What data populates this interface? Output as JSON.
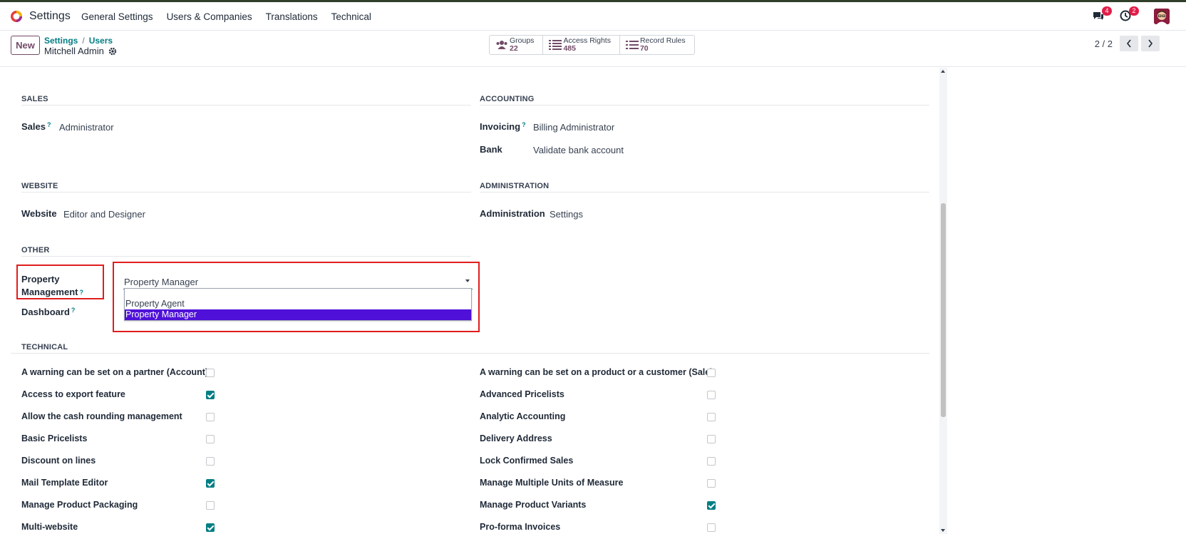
{
  "app": {
    "name": "Settings"
  },
  "menu": [
    "General Settings",
    "Users & Companies",
    "Translations",
    "Technical"
  ],
  "notifications": {
    "messages_count": "4",
    "activities_count": "2"
  },
  "control": {
    "new_label": "New",
    "breadcrumb": [
      "Settings",
      "Users"
    ],
    "record_name": "Mitchell Admin",
    "stats": [
      {
        "label": "Groups",
        "value": "22"
      },
      {
        "label": "Access Rights",
        "value": "485"
      },
      {
        "label": "Record Rules",
        "value": "70"
      }
    ],
    "pager": "2 / 2"
  },
  "sections": {
    "sales": {
      "title": "SALES",
      "fields": [
        {
          "label": "Sales",
          "value": "Administrator"
        }
      ]
    },
    "accounting": {
      "title": "ACCOUNTING",
      "fields": [
        {
          "label": "Invoicing",
          "value": "Billing Administrator"
        },
        {
          "label": "Bank",
          "value": "Validate bank account"
        }
      ]
    },
    "website": {
      "title": "WEBSITE",
      "fields": [
        {
          "label": "Website",
          "value": "Editor and Designer"
        }
      ]
    },
    "administration": {
      "title": "ADMINISTRATION",
      "fields": [
        {
          "label": "Administration",
          "value": "Settings"
        }
      ]
    },
    "other": {
      "title": "OTHER",
      "property_label_1": "Property",
      "property_label_2": "Management",
      "property_value": "Property Manager",
      "options": [
        "Property Agent",
        "Property Manager"
      ],
      "dashboard_label": "Dashboard"
    },
    "technical": {
      "title": "TECHNICAL",
      "left": [
        {
          "label": "A warning can be set on a partner (Account)",
          "checked": false
        },
        {
          "label": "Access to export feature",
          "checked": true
        },
        {
          "label": "Allow the cash rounding management",
          "checked": false
        },
        {
          "label": "Basic Pricelists",
          "checked": false
        },
        {
          "label": "Discount on lines",
          "checked": false
        },
        {
          "label": "Mail Template Editor",
          "checked": true
        },
        {
          "label": "Manage Product Packaging",
          "checked": false
        },
        {
          "label": "Multi-website",
          "checked": true
        }
      ],
      "right": [
        {
          "label": "A warning can be set on a product or a customer (Sale)",
          "checked": false
        },
        {
          "label": "Advanced Pricelists",
          "checked": false
        },
        {
          "label": "Analytic Accounting",
          "checked": false
        },
        {
          "label": "Delivery Address",
          "checked": false
        },
        {
          "label": "Lock Confirmed Sales",
          "checked": false
        },
        {
          "label": "Manage Multiple Units of Measure",
          "checked": false
        },
        {
          "label": "Manage Product Variants",
          "checked": true
        },
        {
          "label": "Pro-forma Invoices",
          "checked": false
        }
      ]
    }
  },
  "colors": {
    "accent": "#714B67",
    "teal": "#017e84",
    "highlight_box": "#e11d1d",
    "option_selected": "#4f10d9"
  }
}
